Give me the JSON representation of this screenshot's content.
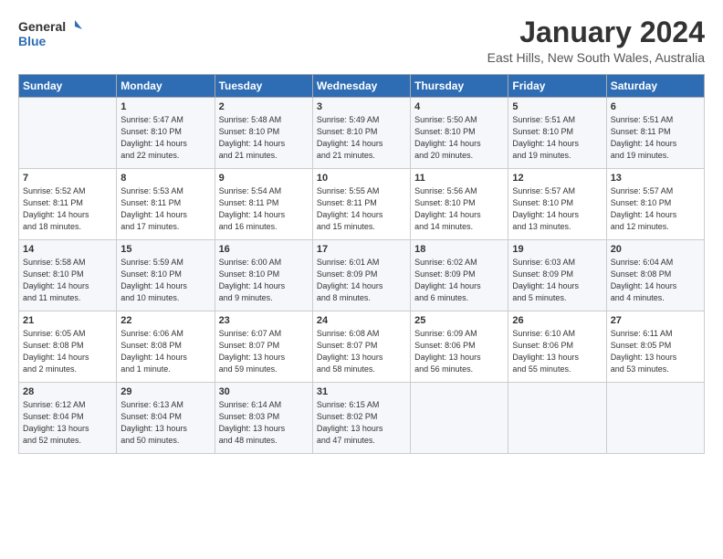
{
  "header": {
    "logo_line1": "General",
    "logo_line2": "Blue",
    "title": "January 2024",
    "subtitle": "East Hills, New South Wales, Australia"
  },
  "days_of_week": [
    "Sunday",
    "Monday",
    "Tuesday",
    "Wednesday",
    "Thursday",
    "Friday",
    "Saturday"
  ],
  "weeks": [
    [
      {
        "day": "",
        "text": ""
      },
      {
        "day": "1",
        "text": "Sunrise: 5:47 AM\nSunset: 8:10 PM\nDaylight: 14 hours\nand 22 minutes."
      },
      {
        "day": "2",
        "text": "Sunrise: 5:48 AM\nSunset: 8:10 PM\nDaylight: 14 hours\nand 21 minutes."
      },
      {
        "day": "3",
        "text": "Sunrise: 5:49 AM\nSunset: 8:10 PM\nDaylight: 14 hours\nand 21 minutes."
      },
      {
        "day": "4",
        "text": "Sunrise: 5:50 AM\nSunset: 8:10 PM\nDaylight: 14 hours\nand 20 minutes."
      },
      {
        "day": "5",
        "text": "Sunrise: 5:51 AM\nSunset: 8:10 PM\nDaylight: 14 hours\nand 19 minutes."
      },
      {
        "day": "6",
        "text": "Sunrise: 5:51 AM\nSunset: 8:11 PM\nDaylight: 14 hours\nand 19 minutes."
      }
    ],
    [
      {
        "day": "7",
        "text": "Sunrise: 5:52 AM\nSunset: 8:11 PM\nDaylight: 14 hours\nand 18 minutes."
      },
      {
        "day": "8",
        "text": "Sunrise: 5:53 AM\nSunset: 8:11 PM\nDaylight: 14 hours\nand 17 minutes."
      },
      {
        "day": "9",
        "text": "Sunrise: 5:54 AM\nSunset: 8:11 PM\nDaylight: 14 hours\nand 16 minutes."
      },
      {
        "day": "10",
        "text": "Sunrise: 5:55 AM\nSunset: 8:11 PM\nDaylight: 14 hours\nand 15 minutes."
      },
      {
        "day": "11",
        "text": "Sunrise: 5:56 AM\nSunset: 8:10 PM\nDaylight: 14 hours\nand 14 minutes."
      },
      {
        "day": "12",
        "text": "Sunrise: 5:57 AM\nSunset: 8:10 PM\nDaylight: 14 hours\nand 13 minutes."
      },
      {
        "day": "13",
        "text": "Sunrise: 5:57 AM\nSunset: 8:10 PM\nDaylight: 14 hours\nand 12 minutes."
      }
    ],
    [
      {
        "day": "14",
        "text": "Sunrise: 5:58 AM\nSunset: 8:10 PM\nDaylight: 14 hours\nand 11 minutes."
      },
      {
        "day": "15",
        "text": "Sunrise: 5:59 AM\nSunset: 8:10 PM\nDaylight: 14 hours\nand 10 minutes."
      },
      {
        "day": "16",
        "text": "Sunrise: 6:00 AM\nSunset: 8:10 PM\nDaylight: 14 hours\nand 9 minutes."
      },
      {
        "day": "17",
        "text": "Sunrise: 6:01 AM\nSunset: 8:09 PM\nDaylight: 14 hours\nand 8 minutes."
      },
      {
        "day": "18",
        "text": "Sunrise: 6:02 AM\nSunset: 8:09 PM\nDaylight: 14 hours\nand 6 minutes."
      },
      {
        "day": "19",
        "text": "Sunrise: 6:03 AM\nSunset: 8:09 PM\nDaylight: 14 hours\nand 5 minutes."
      },
      {
        "day": "20",
        "text": "Sunrise: 6:04 AM\nSunset: 8:08 PM\nDaylight: 14 hours\nand 4 minutes."
      }
    ],
    [
      {
        "day": "21",
        "text": "Sunrise: 6:05 AM\nSunset: 8:08 PM\nDaylight: 14 hours\nand 2 minutes."
      },
      {
        "day": "22",
        "text": "Sunrise: 6:06 AM\nSunset: 8:08 PM\nDaylight: 14 hours\nand 1 minute."
      },
      {
        "day": "23",
        "text": "Sunrise: 6:07 AM\nSunset: 8:07 PM\nDaylight: 13 hours\nand 59 minutes."
      },
      {
        "day": "24",
        "text": "Sunrise: 6:08 AM\nSunset: 8:07 PM\nDaylight: 13 hours\nand 58 minutes."
      },
      {
        "day": "25",
        "text": "Sunrise: 6:09 AM\nSunset: 8:06 PM\nDaylight: 13 hours\nand 56 minutes."
      },
      {
        "day": "26",
        "text": "Sunrise: 6:10 AM\nSunset: 8:06 PM\nDaylight: 13 hours\nand 55 minutes."
      },
      {
        "day": "27",
        "text": "Sunrise: 6:11 AM\nSunset: 8:05 PM\nDaylight: 13 hours\nand 53 minutes."
      }
    ],
    [
      {
        "day": "28",
        "text": "Sunrise: 6:12 AM\nSunset: 8:04 PM\nDaylight: 13 hours\nand 52 minutes."
      },
      {
        "day": "29",
        "text": "Sunrise: 6:13 AM\nSunset: 8:04 PM\nDaylight: 13 hours\nand 50 minutes."
      },
      {
        "day": "30",
        "text": "Sunrise: 6:14 AM\nSunset: 8:03 PM\nDaylight: 13 hours\nand 48 minutes."
      },
      {
        "day": "31",
        "text": "Sunrise: 6:15 AM\nSunset: 8:02 PM\nDaylight: 13 hours\nand 47 minutes."
      },
      {
        "day": "",
        "text": ""
      },
      {
        "day": "",
        "text": ""
      },
      {
        "day": "",
        "text": ""
      }
    ]
  ]
}
